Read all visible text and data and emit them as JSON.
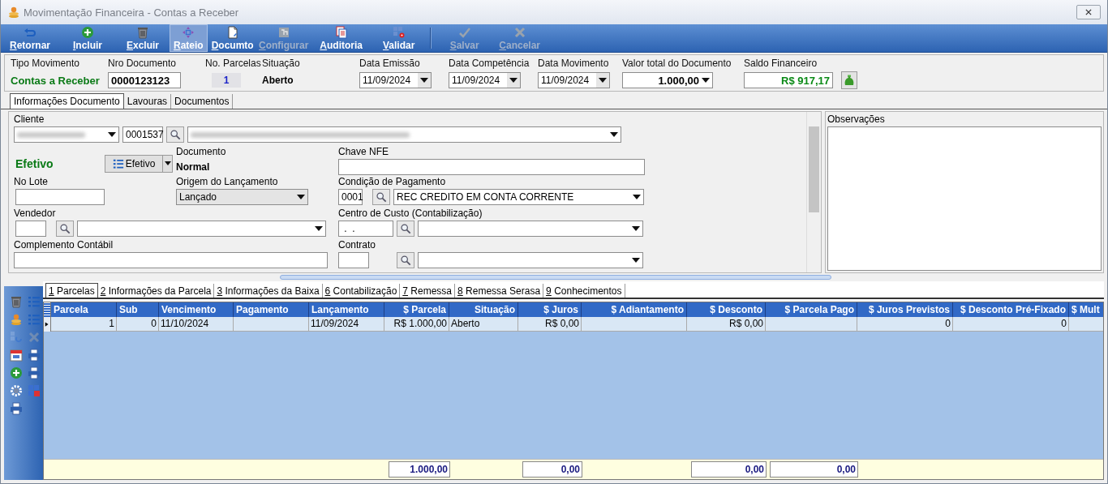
{
  "window": {
    "title": "Movimentação Financeira - Contas a Receber"
  },
  "toolbar": {
    "buttons": [
      {
        "label": "Retornar",
        "disabled": false,
        "selected": false
      },
      {
        "label": "Incluir",
        "disabled": false,
        "selected": false
      },
      {
        "label": "Excluir",
        "disabled": false,
        "selected": false
      },
      {
        "label": "Rateio",
        "disabled": false,
        "selected": true
      },
      {
        "label": "Documto",
        "disabled": false,
        "selected": false
      },
      {
        "label": "Configurar",
        "disabled": true,
        "selected": false
      },
      {
        "label": "Auditoria",
        "disabled": false,
        "selected": false
      },
      {
        "label": "Validar",
        "disabled": false,
        "selected": false
      },
      {
        "label": "Salvar",
        "disabled": true,
        "selected": false
      },
      {
        "label": "Cancelar",
        "disabled": true,
        "selected": false
      }
    ]
  },
  "header": {
    "fields": [
      {
        "kind": "status",
        "label": "Tipo Movimento",
        "value": "Contas a Receber"
      },
      {
        "kind": "input",
        "label": "Nro Documento",
        "value": "0000123123"
      },
      {
        "kind": "count",
        "label": "No. Parcelas",
        "value": "1"
      },
      {
        "kind": "bold",
        "label": "Situação",
        "value": "Aberto"
      },
      {
        "kind": "date",
        "label": "Data Emissão",
        "value": "11/09/2024"
      },
      {
        "kind": "date",
        "label": "Data Competência",
        "value": "11/09/2024"
      },
      {
        "kind": "date",
        "label": "Data Movimento",
        "value": "11/09/2024"
      },
      {
        "kind": "amount",
        "label": "Valor total do Documento",
        "value": "1.000,00"
      },
      {
        "kind": "balance",
        "label": "Saldo Financeiro",
        "value": "R$ 917,17"
      }
    ]
  },
  "top_tabs": [
    {
      "label": "Informações Documento",
      "selected": true
    },
    {
      "label": "Lavouras",
      "selected": false
    },
    {
      "label": "Documentos",
      "selected": false
    }
  ],
  "form": {
    "cliente": {
      "label": "Cliente",
      "code": "0001537"
    },
    "status": "Efetivo",
    "status_button": "Efetivo",
    "documento": {
      "label": "Documento",
      "value": "Normal"
    },
    "chave_nfe": {
      "label": "Chave NFE"
    },
    "no_lote": {
      "label": "No Lote"
    },
    "origem": {
      "label": "Origem do Lançamento",
      "value": "Lançado"
    },
    "condicao": {
      "label": "Condição de Pagamento",
      "code": "0001",
      "value": "REC CREDITO EM CONTA CORRENTE"
    },
    "vendedor": {
      "label": "Vendedor"
    },
    "centro_custo": {
      "label": "Centro de Custo (Contabilização)",
      "value": " .  ."
    },
    "complemento": {
      "label": "Complemento Contábil"
    },
    "contrato": {
      "label": "Contrato"
    }
  },
  "observacoes": {
    "label": "Observações"
  },
  "bottom_tabs": [
    {
      "label": "1 Parcelas",
      "selected": true
    },
    {
      "label": "2 Informações da Parcela",
      "selected": false
    },
    {
      "label": "3 Informações da Baixa",
      "selected": false
    },
    {
      "label": "6 Contabilização",
      "selected": false
    },
    {
      "label": "7 Remessa",
      "selected": false
    },
    {
      "label": "8 Remessa Serasa",
      "selected": false
    },
    {
      "label": "9 Conhecimentos",
      "selected": false
    }
  ],
  "table": {
    "columns": [
      {
        "label": "Parcela"
      },
      {
        "label": "Sub"
      },
      {
        "label": "Vencimento"
      },
      {
        "label": "Pagamento"
      },
      {
        "label": "Lançamento"
      },
      {
        "label": "$ Parcela",
        "total": "1.000,00"
      },
      {
        "label": "Situação"
      },
      {
        "label": "$ Juros",
        "total": "0,00"
      },
      {
        "label": "$ Adiantamento"
      },
      {
        "label": "$ Desconto",
        "total": "0,00"
      },
      {
        "label": "$ Parcela Pago",
        "total": "0,00"
      },
      {
        "label": "$ Juros Previstos"
      },
      {
        "label": "$ Desconto Pré-Fixado"
      },
      {
        "label": "$ Mult"
      }
    ],
    "rows": [
      {
        "selected": true,
        "cells": [
          "1",
          "0",
          "11/10/2024",
          null,
          "11/09/2024",
          "R$ 1.000,00",
          "Aberto",
          "R$ 0,00",
          null,
          "R$ 0,00",
          null,
          "0",
          "0",
          null
        ]
      }
    ]
  }
}
